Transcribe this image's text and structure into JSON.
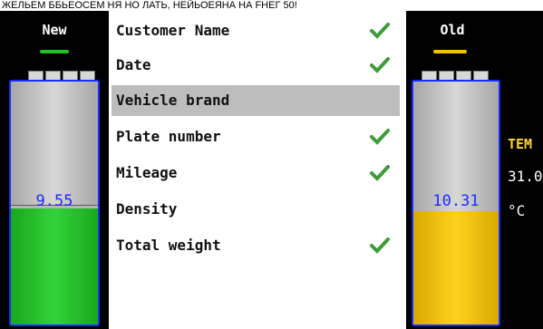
{
  "top_strip": "ЖЕЛЬЕМ ББЬЕОСЕМ НЯ НО ЛАТЬ, НЕЙЬОЕЯНА НА FНЕГ 50!",
  "left_gauge": {
    "title": "New",
    "value": "9.55",
    "level": 0.45,
    "accent": "#20c020"
  },
  "right_gauge": {
    "title": "Old",
    "value": "10.31",
    "level": 0.45,
    "accent": "#f2c200"
  },
  "menu": [
    {
      "label": "Customer Name",
      "checked": true
    },
    {
      "label": "Date",
      "checked": true
    },
    {
      "label": "Vehicle brand",
      "checked": false,
      "selected": true
    },
    {
      "label": "Plate number",
      "checked": true
    },
    {
      "label": "Mileage",
      "checked": true
    },
    {
      "label": "Density",
      "checked": false
    },
    {
      "label": "Total weight",
      "checked": true
    }
  ],
  "side_info": {
    "temp_label": "TEM",
    "temp_value": "31.0",
    "unit": "°C"
  }
}
